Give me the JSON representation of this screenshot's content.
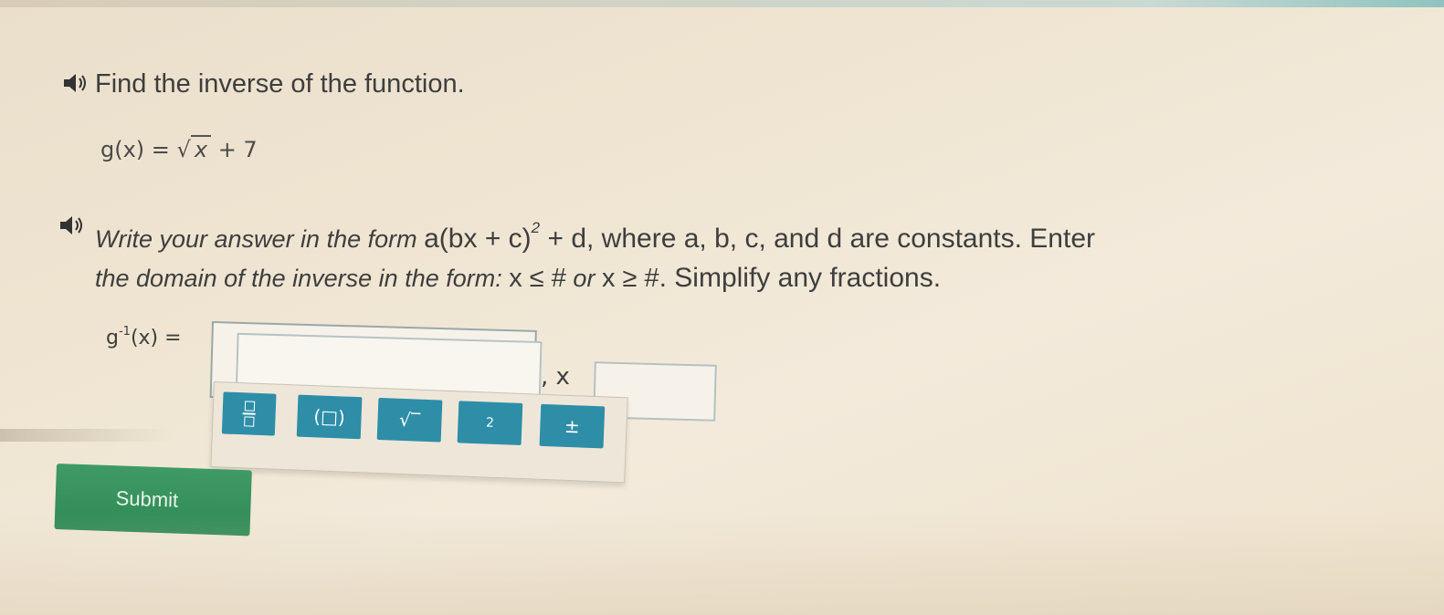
{
  "question": {
    "title": "Find the inverse of the function.",
    "function_lhs": "g(x) =",
    "function_radicand": "x",
    "function_tail": "+ 7"
  },
  "instructions": {
    "line1_prefix": "Write your answer in the form ",
    "line1_form": "a(bx + c)",
    "line1_exp": "2",
    "line1_form_tail": " + d",
    "line1_suffix": ", where a, b, c, and d are constants. Enter",
    "line2_prefix": "the domain of the inverse in the form: ",
    "line2_form1": "x ≤ #",
    "line2_or": " or ",
    "line2_form2": "x ≥ #",
    "line2_suffix": ". Simplify any fractions."
  },
  "answer": {
    "label_g": "g",
    "label_sup": "-1",
    "label_tail": "(x) =",
    "inverse_value": "",
    "separator": ", x",
    "domain_value": ""
  },
  "toolbar": {
    "fraction_symbol": "□/□",
    "paren_symbol": "(□)",
    "sqrt_symbol": "√‾",
    "square_symbol": "2",
    "plusminus_symbol": "±"
  },
  "submit_label": "Submit",
  "colors": {
    "toolbar_button": "#2e8ea8",
    "submit_button": "#3f9a66",
    "background": "#efe5d2"
  }
}
